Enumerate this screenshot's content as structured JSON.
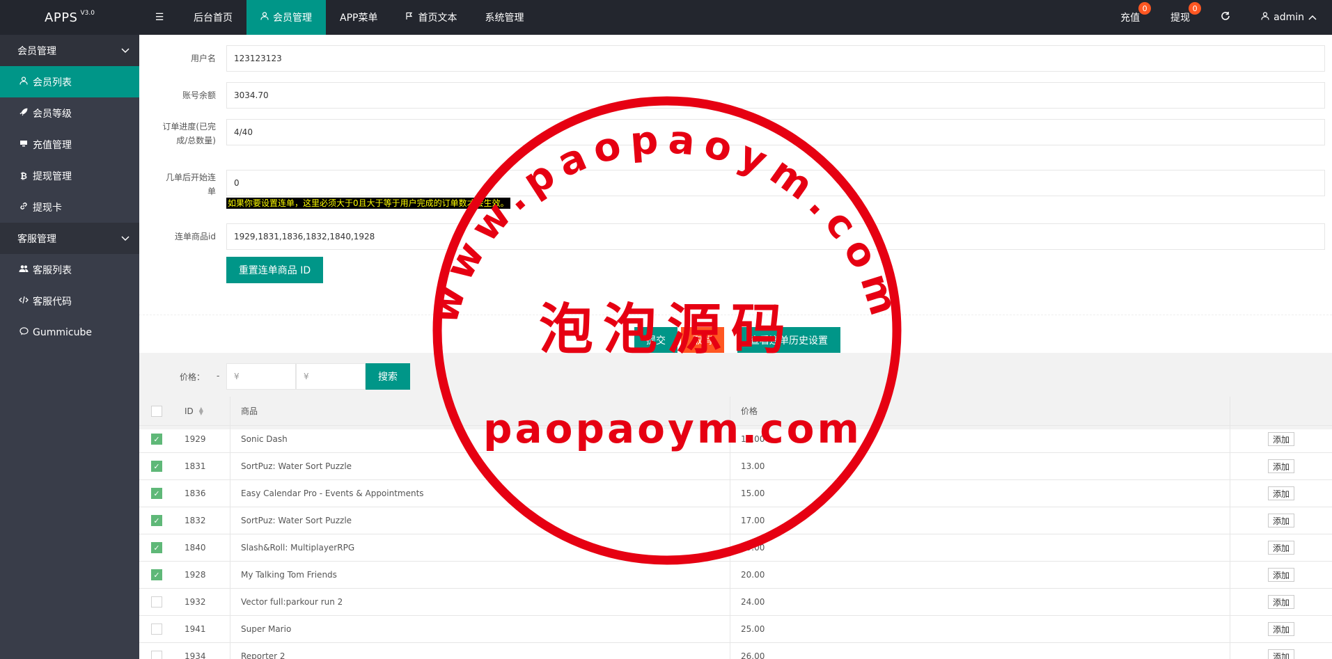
{
  "app": {
    "brand": "APPS",
    "version": "V3.0"
  },
  "topnav": [
    {
      "label": "后台首页",
      "icon": ""
    },
    {
      "label": "会员管理",
      "icon": "user-icon",
      "active": true
    },
    {
      "label": "APP菜单",
      "icon": ""
    },
    {
      "label": "首页文本",
      "icon": "flag-icon"
    },
    {
      "label": "系统管理",
      "icon": ""
    }
  ],
  "topright": {
    "recharge_label": "充值",
    "recharge_count": "0",
    "withdraw_label": "提现",
    "withdraw_count": "0",
    "user_label": "admin"
  },
  "sidebar": {
    "group1": "会员管理",
    "items1": [
      {
        "label": "会员列表",
        "icon": "user-icon",
        "active": true
      },
      {
        "label": "会员等级",
        "icon": "rocket-icon"
      },
      {
        "label": "充值管理",
        "icon": "monitor-icon"
      },
      {
        "label": "提现管理",
        "icon": "bitcoin-icon"
      },
      {
        "label": "提现卡",
        "icon": "link-icon"
      }
    ],
    "group2": "客服管理",
    "items2": [
      {
        "label": "客服列表",
        "icon": "users-icon"
      },
      {
        "label": "客服代码",
        "icon": "code-icon"
      },
      {
        "label": "Gummicube",
        "icon": "chat-icon"
      }
    ]
  },
  "form": {
    "username_label": "用户名",
    "username_value": "123123123",
    "balance_label": "账号余额",
    "balance_value": "3034.70",
    "progress_label_1": "订单进度(已完",
    "progress_label_2": "成/总数量)",
    "progress_value": "4/40",
    "start_label_1": "几单后开始连",
    "start_label_2": "单",
    "start_value": "0",
    "hint": "如果你要设置连单，这里必须大于0且大于等于用户完成的订单数才会生效。",
    "goods_label": "连单商品id",
    "goods_value": "1929,1831,1836,1832,1840,1928",
    "reset_button": "重置连单商品 ID",
    "submit_button": "提交",
    "cancel_button": "取消",
    "history_button": "查看连单历史设置"
  },
  "search": {
    "price_label": "价格：",
    "dash": "-",
    "min_placeholder": "¥",
    "max_placeholder": "¥",
    "button": "搜索"
  },
  "table": {
    "headers": {
      "id": "ID",
      "name": "商品",
      "price": "价格"
    },
    "add_label": "添加",
    "rows": [
      {
        "checked": true,
        "id": "1929",
        "name": "Sonic Dash",
        "price": "10.00"
      },
      {
        "checked": true,
        "id": "1831",
        "name": "SortPuz: Water Sort Puzzle",
        "price": "13.00"
      },
      {
        "checked": true,
        "id": "1836",
        "name": "Easy Calendar Pro - Events & Appointments",
        "price": "15.00"
      },
      {
        "checked": true,
        "id": "1832",
        "name": "SortPuz: Water Sort Puzzle",
        "price": "17.00"
      },
      {
        "checked": true,
        "id": "1840",
        "name": "Slash&Roll: MultiplayerRPG",
        "price": "19.00"
      },
      {
        "checked": true,
        "id": "1928",
        "name": "My Talking Tom Friends",
        "price": "20.00"
      },
      {
        "checked": false,
        "id": "1932",
        "name": "Vector full:parkour run 2",
        "price": "24.00"
      },
      {
        "checked": false,
        "id": "1941",
        "name": "Super Mario",
        "price": "25.00"
      },
      {
        "checked": false,
        "id": "1934",
        "name": "Reporter 2",
        "price": "26.00"
      }
    ]
  },
  "watermark": {
    "url_text": "www.paopaoym.com",
    "cn_text": "泡泡源码",
    "bottom_text": "paopaoym.com",
    "color": "#e60012"
  }
}
